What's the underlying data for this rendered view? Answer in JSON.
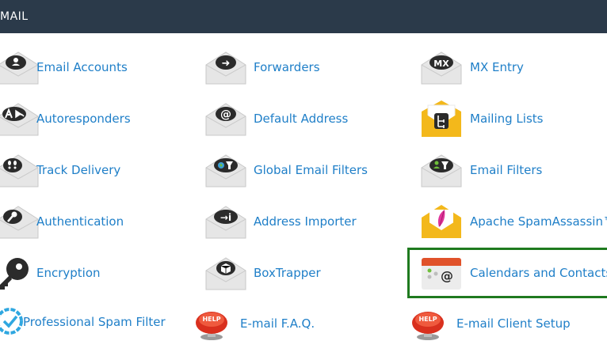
{
  "header": {
    "title": "MAIL"
  },
  "items": {
    "email_accounts": "Email Accounts",
    "forwarders": "Forwarders",
    "mx_entry": "MX Entry",
    "autoresponders": "Autoresponders",
    "default_address": "Default Address",
    "mailing_lists": "Mailing Lists",
    "track_delivery": "Track Delivery",
    "global_email_filters": "Global Email Filters",
    "email_filters": "Email Filters",
    "authentication": "Authentication",
    "address_importer": "Address Importer",
    "apache_spamassassin": "Apache SpamAssassin™",
    "encryption": "Encryption",
    "boxtrapper": "BoxTrapper",
    "calendars_and_contacts": "Calendars and Contacts",
    "professional_spam_filter": "Professional Spam Filter",
    "email_faq": "E-mail F.A.Q.",
    "email_client_setup": "E-mail Client Setup"
  },
  "icon_glyphs": {
    "forwarders": "➜",
    "mx_entry": "MX",
    "default_address": "@",
    "address_importer": "→i"
  },
  "help_badge": "HELP",
  "colors": {
    "header_bg": "#2b3a4a",
    "link": "#1f7fc8",
    "highlight": "#1f7a1f",
    "envelope": "#e6e6e6",
    "envelope_dark": "#bdbdbd",
    "badge": "#2b2b2b",
    "help_red": "#d9301e",
    "calendar_red": "#e0522a",
    "mailing_yellow": "#f3b81b"
  }
}
